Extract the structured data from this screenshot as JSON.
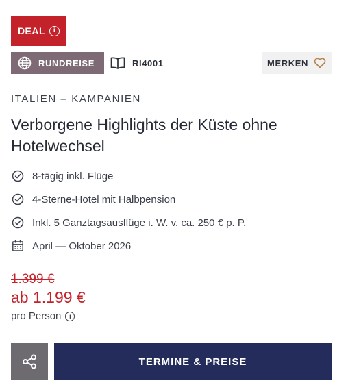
{
  "badge": {
    "label": "DEAL",
    "icon": "info-icon"
  },
  "tags": {
    "type_label": "RUNDREISE",
    "type_icon": "globe-icon",
    "code": "RI4001",
    "code_icon": "book-icon",
    "bookmark_label": "MERKEN",
    "bookmark_icon": "heart-icon"
  },
  "trip": {
    "region": "ITALIEN – KAMPANIEN",
    "title": "Verborgene Highlights der Küste ohne Hotelwechsel"
  },
  "features": [
    {
      "icon": "check-circle-icon",
      "text": "8-tägig inkl. Flüge"
    },
    {
      "icon": "check-circle-icon",
      "text": "4-Sterne-Hotel mit Halbpension"
    },
    {
      "icon": "check-circle-icon",
      "text": "Inkl. 5 Ganztagsausflüge i. W. v. ca. 250 € p. P."
    },
    {
      "icon": "calendar-icon",
      "text": "April — Oktober 2026"
    }
  ],
  "price": {
    "old": "1.399 €",
    "current": "ab 1.199 €",
    "per_person": "pro Person"
  },
  "actions": {
    "share_icon": "share-icon",
    "cta_label": "TERMINE & PREISE"
  },
  "colors": {
    "deal": "#c4222a",
    "type_tag": "#7d6a74",
    "cta": "#232c5b",
    "share": "#6e6b70",
    "heart": "#b5824a"
  }
}
